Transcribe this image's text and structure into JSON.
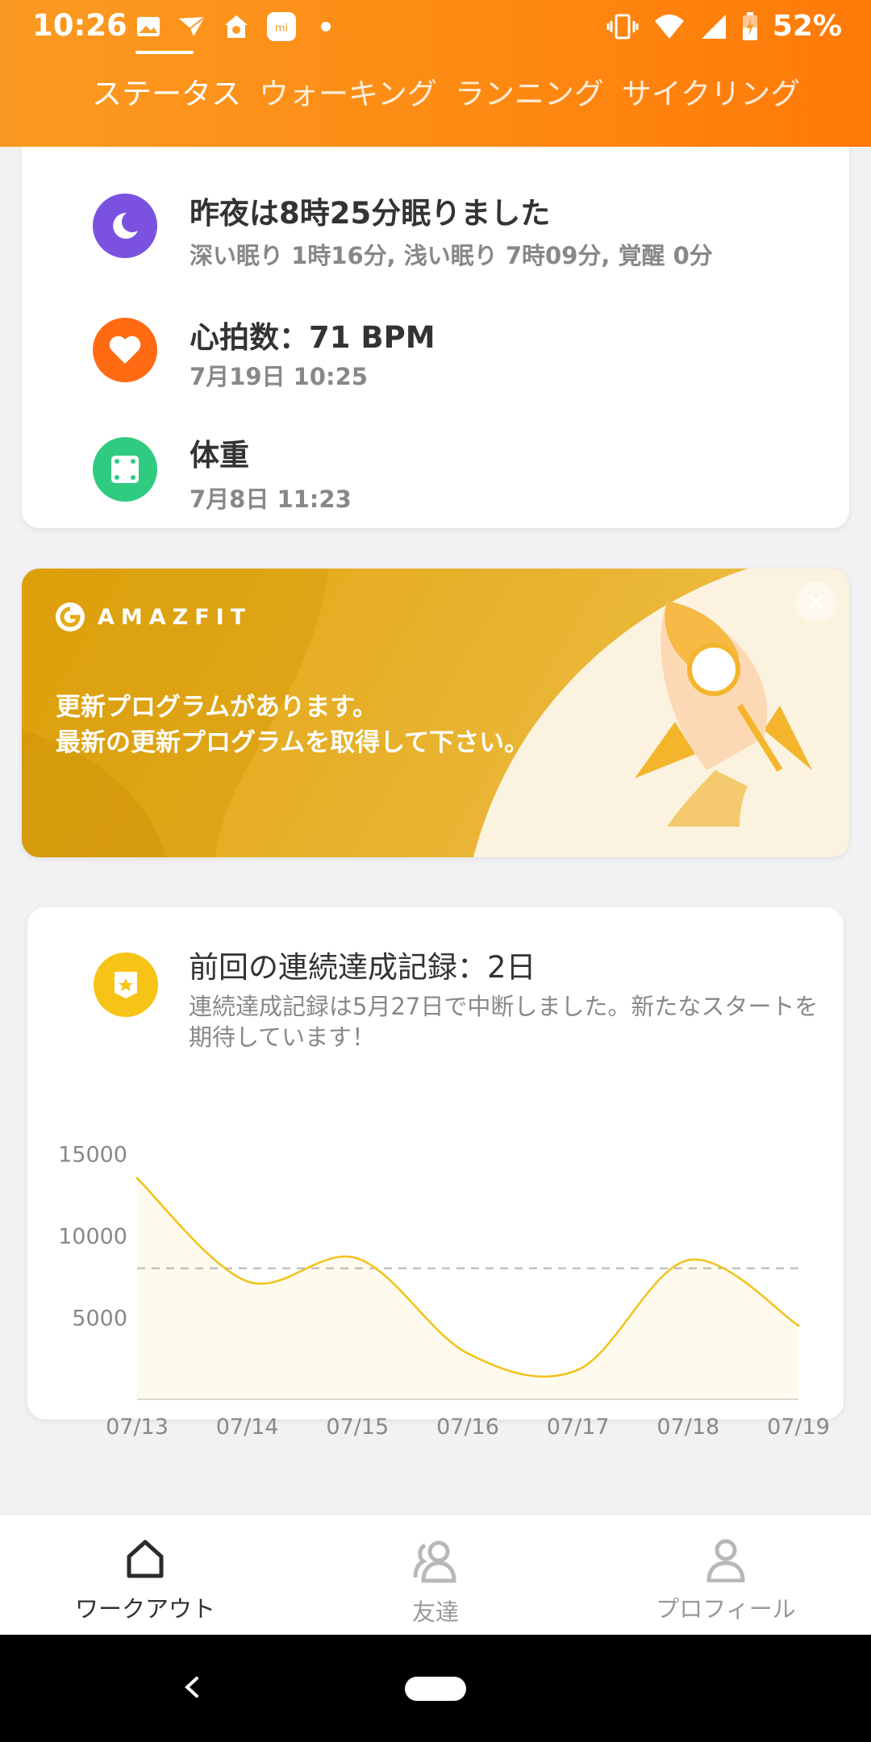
{
  "status_bar": {
    "time": "10:26",
    "battery": "52%",
    "icons_left": [
      "gallery-icon",
      "bird-icon",
      "home-app-icon",
      "mi-icon"
    ],
    "icons_right": [
      "vibrate-icon",
      "wifi-icon",
      "signal-icon",
      "battery-icon"
    ]
  },
  "tabs": [
    {
      "label": "ステータス",
      "active": true
    },
    {
      "label": "ウォーキング",
      "active": false
    },
    {
      "label": "ランニング",
      "active": false
    },
    {
      "label": "サイクリング",
      "active": false
    }
  ],
  "health_card": {
    "sleep": {
      "title": "昨夜は8時25分眠りました",
      "detail": "深い眠り 1時16分, 浅い眠り 7時09分, 覚醒 0分",
      "icon": "moon-icon",
      "color": "#7b52e0"
    },
    "heart": {
      "title": "心拍数：71 BPM",
      "detail": "7月19日 10:25",
      "icon": "heart-icon",
      "color": "#ff6a13"
    },
    "weight": {
      "title": "体重",
      "detail": "7月8日 11:23",
      "icon": "scale-icon",
      "color": "#2fcb80"
    }
  },
  "banner": {
    "brand": "AMAZFIT",
    "line1": "更新プログラムがあります。",
    "line2": "最新の更新プログラムを取得して下さい。"
  },
  "streak_card": {
    "title": "前回の連続達成記録：2日",
    "description": "連続達成記録は5月27日で中断しました。新たなスタートを期待しています！"
  },
  "chart_data": {
    "type": "line",
    "categories": [
      "07/13",
      "07/14",
      "07/15",
      "07/16",
      "07/17",
      "07/18",
      "07/19"
    ],
    "values": [
      13500,
      7200,
      8600,
      2800,
      1800,
      8500,
      4500
    ],
    "y_ticks": [
      "15000",
      "10000",
      "5000"
    ],
    "goal_line": 8000,
    "ylim": [
      0,
      16500
    ],
    "color": "#f2c21a"
  },
  "bottom_nav": {
    "items": [
      {
        "label": "ワークアウト",
        "icon": "home-icon",
        "active": true
      },
      {
        "label": "友達",
        "icon": "friends-icon",
        "active": false
      },
      {
        "label": "プロフィール",
        "icon": "profile-icon",
        "active": false
      }
    ]
  },
  "colors": {
    "header": "#fd8a12",
    "accent": "#f7c316"
  }
}
